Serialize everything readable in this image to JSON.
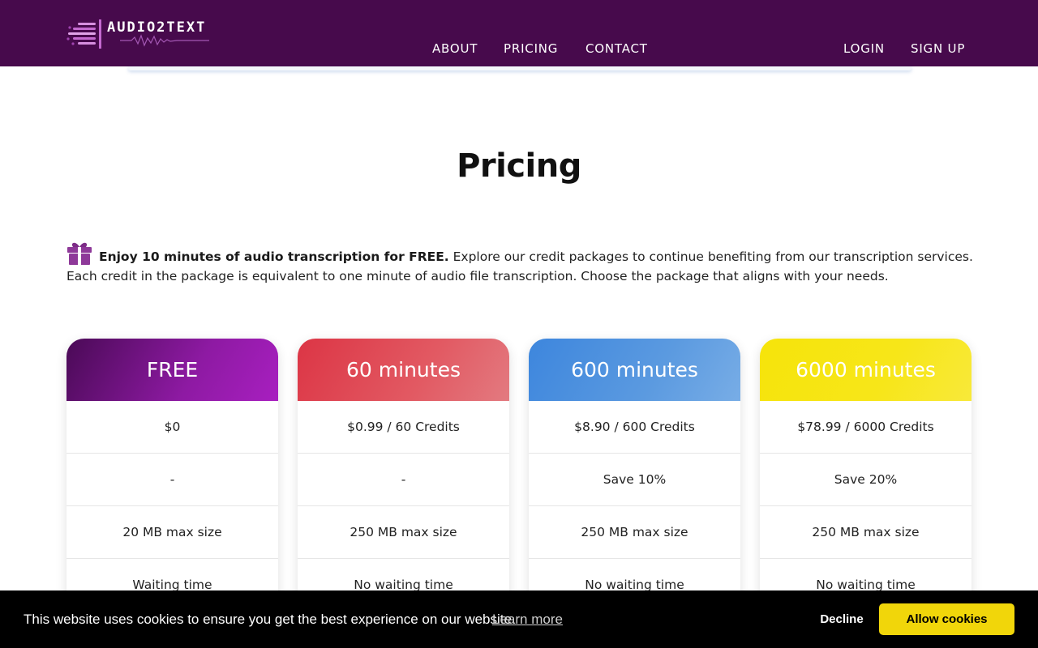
{
  "header": {
    "logo_text": "AUDIO2TEXT",
    "nav": {
      "about": "ABOUT",
      "pricing": "PRICING",
      "contact": "CONTACT",
      "login": "LOGIN",
      "signup": "SIGN UP"
    },
    "bg_color": "#470a4c"
  },
  "main": {
    "title": "Pricing",
    "intro": {
      "bold": "Enjoy 10 minutes of audio transcription for FREE.",
      "line1_rest": " Explore our credit packages to continue benefiting from our transcription services.",
      "line2": "Each credit in the package is equivalent to one minute of audio file transcription. Choose the package that aligns with your needs."
    }
  },
  "plans": [
    {
      "name": "FREE",
      "price": "$0",
      "saving": "-",
      "max_size": "20 MB max size",
      "waiting": "Waiting time"
    },
    {
      "name": "60 minutes",
      "price": "$0.99 / 60 Credits",
      "saving": "-",
      "max_size": "250 MB max size",
      "waiting": "No waiting time"
    },
    {
      "name": "600 minutes",
      "price": "$8.90 / 600 Credits",
      "saving": "Save 10%",
      "max_size": "250 MB max size",
      "waiting": "No waiting time"
    },
    {
      "name": "6000 minutes",
      "price": "$78.99 / 6000 Credits",
      "saving": "Save 20%",
      "max_size": "250 MB max size",
      "waiting": "No waiting time"
    }
  ],
  "cookie_banner": {
    "message": "This website uses cookies to ensure you get the best experience on our website.",
    "learn_more": "Learn more",
    "decline": "Decline",
    "allow": "Allow cookies",
    "allow_color": "#f1d60a"
  },
  "icons": {
    "logo": "audio-logo-icon",
    "gift": "gift-icon"
  }
}
